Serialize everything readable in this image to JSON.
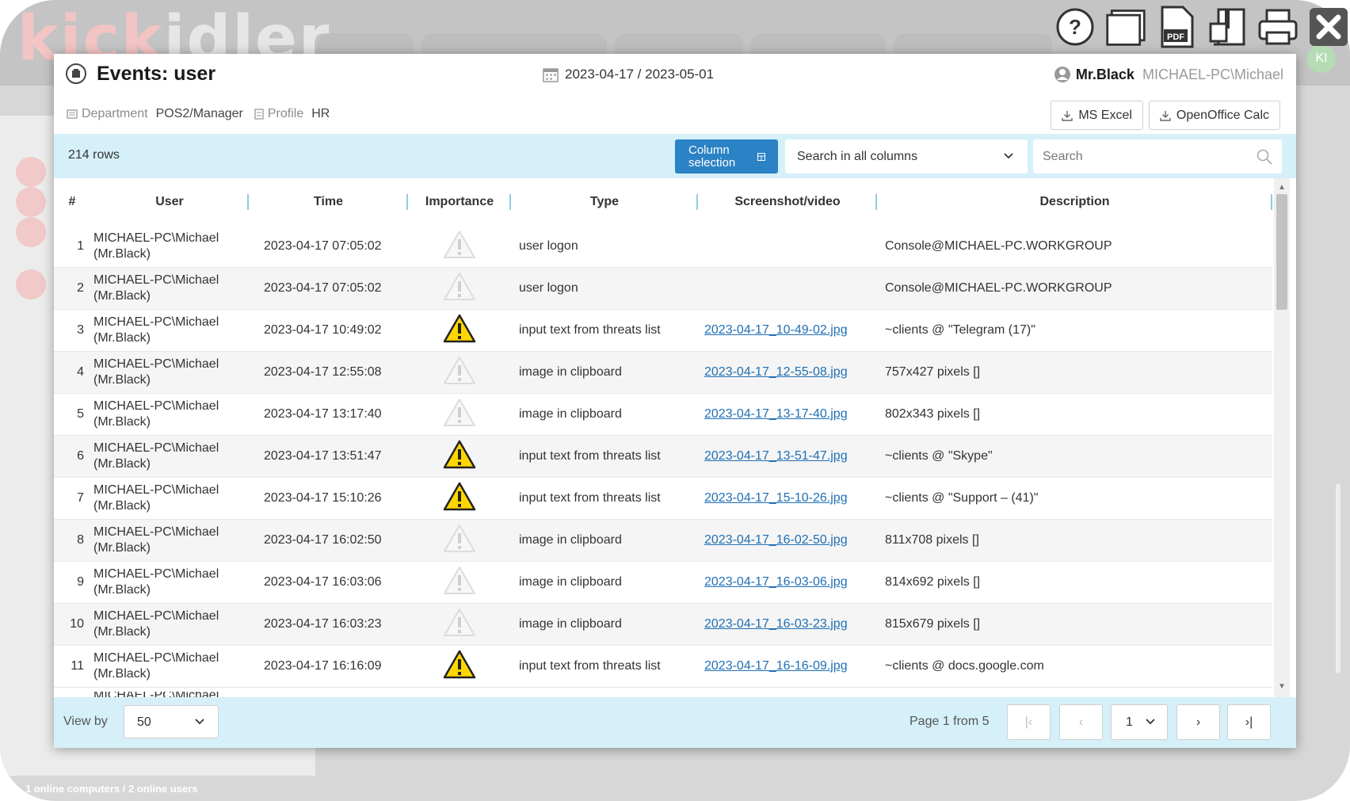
{
  "background": {
    "logo_red": "kick",
    "logo_rest": "idler",
    "avatar_initials": "KI",
    "status_text": "1 online computers / 2 online users"
  },
  "top_tools": [
    "help-icon",
    "window-icon",
    "pdf-icon",
    "archive-icon",
    "print-icon",
    "close-icon"
  ],
  "top_tools_pdf_label": "PDF",
  "modal": {
    "title": "Events: user",
    "date_range": "2023-04-17 / 2023-05-01",
    "user_name": "Mr.Black",
    "user_pc": "MICHAEL-PC\\Michael",
    "department_label": "Department",
    "department_value": "POS2/Manager",
    "profile_label": "Profile",
    "profile_value": "HR",
    "export": {
      "excel": "MS Excel",
      "calc": "OpenOffice Calc"
    }
  },
  "toolbar": {
    "rows_count": "214 rows",
    "column_selection_line1": "Column",
    "column_selection_line2": "selection",
    "search_scope": "Search in all columns",
    "search_placeholder": "Search"
  },
  "table": {
    "columns": [
      "#",
      "User",
      "Time",
      "Importance",
      "Type",
      "Screenshot/video",
      "Description"
    ],
    "rows": [
      {
        "num": "1",
        "user1": "MICHAEL-PC\\Michael",
        "user2": "(Mr.Black)",
        "time": "2023-04-17 07:05:02",
        "importance": "low",
        "type": "user logon",
        "shot": "",
        "desc": "Console@MICHAEL-PC.WORKGROUP"
      },
      {
        "num": "2",
        "user1": "MICHAEL-PC\\Michael",
        "user2": "(Mr.Black)",
        "time": "2023-04-17 07:05:02",
        "importance": "low",
        "type": "user logon",
        "shot": "",
        "desc": "Console@MICHAEL-PC.WORKGROUP"
      },
      {
        "num": "3",
        "user1": "MICHAEL-PC\\Michael",
        "user2": "(Mr.Black)",
        "time": "2023-04-17 10:49:02",
        "importance": "high",
        "type": "input text from threats list",
        "shot": "2023-04-17_10-49-02.jpg",
        "desc": "~clients @ \"Telegram (17)\""
      },
      {
        "num": "4",
        "user1": "MICHAEL-PC\\Michael",
        "user2": "(Mr.Black)",
        "time": "2023-04-17 12:55:08",
        "importance": "low",
        "type": "image in clipboard",
        "shot": "2023-04-17_12-55-08.jpg",
        "desc": "757x427 pixels []"
      },
      {
        "num": "5",
        "user1": "MICHAEL-PC\\Michael",
        "user2": "(Mr.Black)",
        "time": "2023-04-17 13:17:40",
        "importance": "low",
        "type": "image in clipboard",
        "shot": "2023-04-17_13-17-40.jpg",
        "desc": "802x343 pixels []"
      },
      {
        "num": "6",
        "user1": "MICHAEL-PC\\Michael",
        "user2": "(Mr.Black)",
        "time": "2023-04-17 13:51:47",
        "importance": "high",
        "type": "input text from threats list",
        "shot": "2023-04-17_13-51-47.jpg",
        "desc": "~clients @ \"Skype\""
      },
      {
        "num": "7",
        "user1": "MICHAEL-PC\\Michael",
        "user2": "(Mr.Black)",
        "time": "2023-04-17 15:10:26",
        "importance": "high",
        "type": "input text from threats list",
        "shot": "2023-04-17_15-10-26.jpg",
        "desc": "~clients @ \"Support – (41)\""
      },
      {
        "num": "8",
        "user1": "MICHAEL-PC\\Michael",
        "user2": "(Mr.Black)",
        "time": "2023-04-17 16:02:50",
        "importance": "low",
        "type": "image in clipboard",
        "shot": "2023-04-17_16-02-50.jpg",
        "desc": "811x708 pixels []"
      },
      {
        "num": "9",
        "user1": "MICHAEL-PC\\Michael",
        "user2": "(Mr.Black)",
        "time": "2023-04-17 16:03:06",
        "importance": "low",
        "type": "image in clipboard",
        "shot": "2023-04-17_16-03-06.jpg",
        "desc": "814x692 pixels []"
      },
      {
        "num": "10",
        "user1": "MICHAEL-PC\\Michael",
        "user2": "(Mr.Black)",
        "time": "2023-04-17 16:03:23",
        "importance": "low",
        "type": "image in clipboard",
        "shot": "2023-04-17_16-03-23.jpg",
        "desc": "815x679 pixels []"
      },
      {
        "num": "11",
        "user1": "MICHAEL-PC\\Michael",
        "user2": "(Mr.Black)",
        "time": "2023-04-17 16:16:09",
        "importance": "high",
        "type": "input text from threats list",
        "shot": "2023-04-17_16-16-09.jpg",
        "desc": "~clients @ docs.google.com"
      }
    ]
  },
  "footer": {
    "view_by_label": "View by",
    "view_by_value": "50",
    "page_info": "Page 1 from 5",
    "page_select": "1",
    "first": "|‹",
    "prev": "‹",
    "next": "›",
    "last": "›|"
  },
  "colors": {
    "accent": "#2b82c4",
    "strip": "#d5f0f9",
    "link": "#1f6fb5",
    "warning": "#ffd600"
  }
}
